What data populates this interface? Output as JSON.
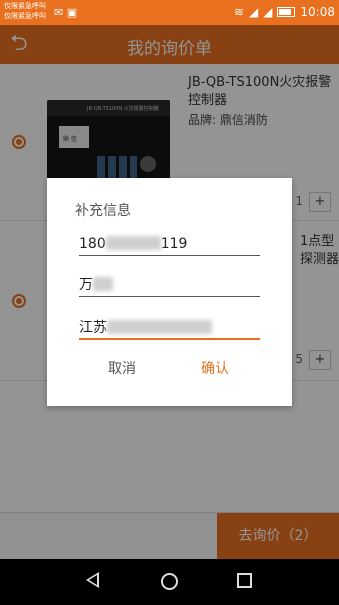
{
  "status_bar": {
    "carrier_line1": "仅限紧急呼叫",
    "carrier_line2": "仅限紧急呼叫",
    "time": "10:08",
    "icons": [
      "wifi-icon",
      "signal-icon",
      "signal-icon",
      "battery-icon",
      "message-icon",
      "image-icon"
    ]
  },
  "header": {
    "title": "我的询价单",
    "back_icon": "back-arrow-icon"
  },
  "products": [
    {
      "title": "JB-QB-TS100N火灾报警控制器",
      "brand": "品牌: 鼎信消防",
      "thumb_band": "JB-QB-TS100N  火灾报警控制器",
      "screen_text": "鼎 信",
      "qty_visible": "1",
      "plus": "+",
      "selected": true
    },
    {
      "title": "1点型\n探测器",
      "qty_visible": "5",
      "plus": "+",
      "selected": true
    }
  ],
  "dialog": {
    "title": "补充信息",
    "phone_prefix": "180",
    "phone_suffix": "119",
    "name_visible": "万",
    "address_visible": "江苏",
    "cancel_label": "取消",
    "confirm_label": "确认"
  },
  "bottom": {
    "inquiry_button": "去询价（2）"
  },
  "nav": {
    "back_icon": "nav-back-icon",
    "home_icon": "nav-home-icon",
    "recents_icon": "nav-recents-icon"
  },
  "colors": {
    "accent": "#e8701f",
    "overlay": "rgba(0,0,0,0.42)"
  }
}
